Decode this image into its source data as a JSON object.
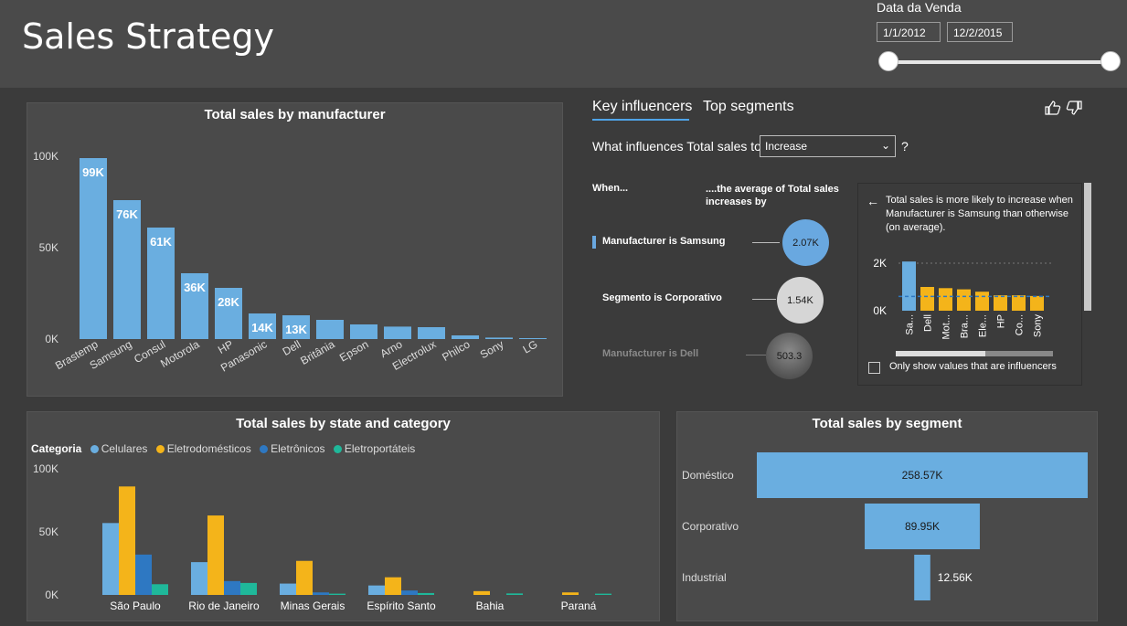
{
  "header": {
    "title": "Sales Strategy"
  },
  "date_slicer": {
    "label": "Data da Venda",
    "start": "1/1/2012",
    "end": "12/2/2015"
  },
  "manufacturer_chart": {
    "title": "Total sales by manufacturer",
    "chart_data": {
      "type": "bar",
      "title": "Total sales by manufacturer",
      "categories": [
        "Brastemp",
        "Samsung",
        "Consul",
        "Motorola",
        "HP",
        "Panasonic",
        "Dell",
        "Britânia",
        "Epson",
        "Arno",
        "Electrolux",
        "Philco",
        "Sony",
        "LG"
      ],
      "values": [
        99000,
        76000,
        61000,
        36000,
        28000,
        14000,
        13000,
        10500,
        8000,
        6800,
        6500,
        2000,
        800,
        500
      ],
      "data_labels": [
        "99K",
        "76K",
        "61K",
        "36K",
        "28K",
        "14K",
        "13K",
        "",
        "",
        "",
        "",
        "",
        "",
        ""
      ],
      "yticks": [
        "0K",
        "50K",
        "100K"
      ],
      "ylim": [
        0,
        100000
      ],
      "color": "#6aaee0"
    }
  },
  "key_influencers": {
    "tab_active": "Key influencers",
    "tab_other": "Top segments",
    "question": "What influences Total sales to",
    "dropdown_value": "Increase",
    "qmark": "?",
    "when_label": "When...",
    "avg_label": "....the average of Total sales increases by",
    "rows": [
      {
        "label": "Manufacturer is Samsung",
        "value": "2.07K"
      },
      {
        "label": "Segmento is Corporativo",
        "value": "1.54K"
      },
      {
        "label": "Manufacturer is Dell",
        "value": "503.3"
      }
    ],
    "detail_text": "Total sales is more likely to increase when Manufacturer is Samsung than otherwise (on average).",
    "detail_chart": {
      "type": "bar",
      "categories": [
        "Sa...",
        "Dell",
        "Mot...",
        "Bra...",
        "Ele...",
        "HP",
        "Co...",
        "Sony"
      ],
      "values": [
        2070,
        1000,
        950,
        900,
        800,
        650,
        650,
        620
      ],
      "yticks": [
        "0K",
        "2K"
      ],
      "average": 600,
      "highlight_color": "#6aaee0",
      "color": "#f4b41a"
    },
    "checkbox_label": "Only show values that are influencers"
  },
  "state_chart": {
    "title": "Total sales by state and category",
    "legend_title": "Categoria",
    "chart_data": {
      "type": "bar",
      "title": "Total sales by state and category",
      "categories": [
        "São Paulo",
        "Rio de Janeiro",
        "Minas Gerais",
        "Espírito Santo",
        "Bahia",
        "Paraná"
      ],
      "series": [
        {
          "name": "Celulares",
          "color": "#6aaee0",
          "values": [
            57000,
            26000,
            9000,
            7500,
            0,
            0
          ]
        },
        {
          "name": "Eletrodomésticos",
          "color": "#f4b41a",
          "values": [
            86000,
            63000,
            27000,
            14000,
            3000,
            2000
          ]
        },
        {
          "name": "Eletrônicos",
          "color": "#2e78c2",
          "values": [
            32000,
            11000,
            2000,
            3500,
            0,
            0
          ]
        },
        {
          "name": "Eletroportáteis",
          "color": "#1fb89a",
          "values": [
            8500,
            9500,
            1000,
            1500,
            1200,
            1000
          ]
        }
      ],
      "yticks": [
        "0K",
        "50K",
        "100K"
      ],
      "ylim": [
        0,
        100000
      ]
    }
  },
  "segment_chart": {
    "title": "Total sales by segment",
    "chart_data": {
      "type": "bar",
      "title": "Total sales by segment",
      "categories": [
        "Doméstico",
        "Corporativo",
        "Industrial"
      ],
      "values": [
        258570,
        89950,
        12560
      ],
      "data_labels": [
        "258.57K",
        "89.95K",
        "12.56K"
      ],
      "color": "#6aaee0"
    }
  }
}
